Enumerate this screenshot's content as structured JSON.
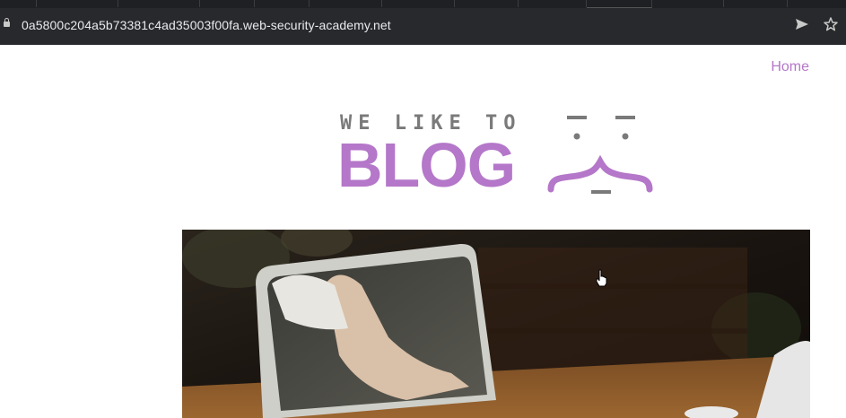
{
  "browser": {
    "url": "0a5800c204a5b73381c4ad35003f00fa.web-security-academy.net",
    "icons": [
      "lock-icon",
      "send-icon",
      "bookmark-star-icon"
    ]
  },
  "nav": {
    "home_label": "Home"
  },
  "logo": {
    "tagline": "WE LIKE TO",
    "name": "BLOG"
  },
  "colors": {
    "accent": "#b477c9",
    "toolbar": "#28292c",
    "logo_gray": "#7a7a7a"
  },
  "hero": {
    "description_icon": "blog-post-image"
  }
}
